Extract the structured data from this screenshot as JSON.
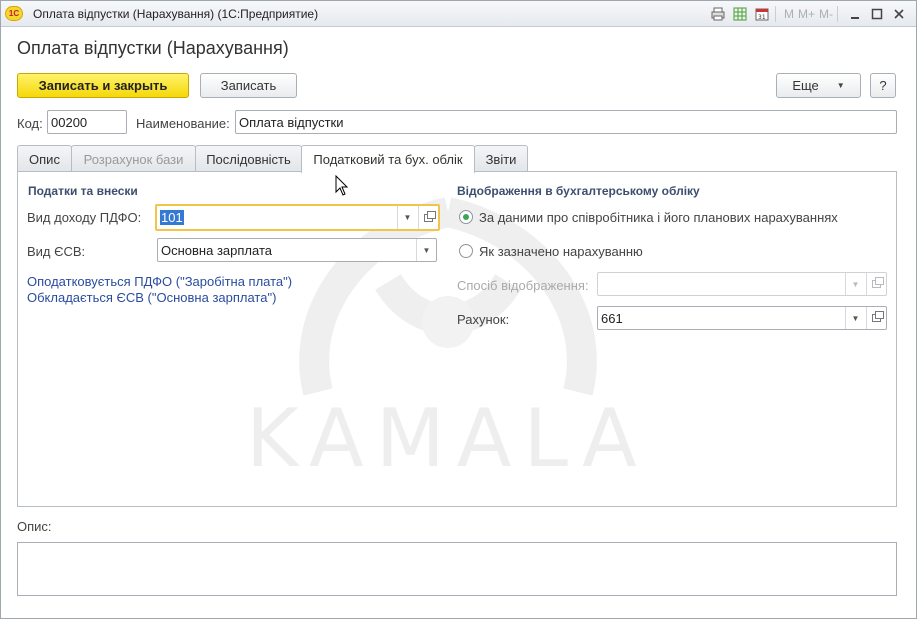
{
  "window": {
    "app_logo": "1С",
    "title": "Оплата відпустки (Нарахування)  (1С:Предприятие)",
    "toolbar_icons": [
      "print-icon",
      "table-icon",
      "calendar-icon"
    ],
    "toolbar_m": [
      "M",
      "M+",
      "M-"
    ],
    "controls": [
      "minimize-icon",
      "maximize-icon",
      "close-icon"
    ]
  },
  "form": {
    "title": "Оплата відпустки (Нарахування)",
    "save_close_label": "Записать и закрыть",
    "save_label": "Записать",
    "more_label": "Еще",
    "help_label": "?"
  },
  "fields": {
    "code_label": "Код:",
    "code_value": "00200",
    "name_label": "Наименование:",
    "name_value": "Оплата відпустки"
  },
  "tabs": [
    {
      "label": "Опис"
    },
    {
      "label": "Розрахунок бази"
    },
    {
      "label": "Послідовність"
    },
    {
      "label": "Податковий та бух. облік"
    },
    {
      "label": "Звіти"
    }
  ],
  "taxes": {
    "section_title": "Податки та внески",
    "income_label": "Вид доходу ПДФО:",
    "income_value": "101",
    "esv_label": "Вид ЄСВ:",
    "esv_value": "Основна зарплата",
    "link_pdfo": "Оподатковується ПДФО (\"Заробітна плата\")",
    "link_esv": "Обкладається ЄСВ (\"Основна зарплата\")"
  },
  "accounting": {
    "section_title": "Відображення в бухгалтерському обліку",
    "radio1": "За даними про співробітника і його планових нарахуваннях",
    "radio2": "Як зазначено нарахуванню",
    "method_label": "Спосіб відображення:",
    "method_value": "",
    "account_label": "Рахунок:",
    "account_value": "661"
  },
  "watermark": {
    "text": "KAMALA"
  },
  "description": {
    "label": "Опис:",
    "value": ""
  }
}
